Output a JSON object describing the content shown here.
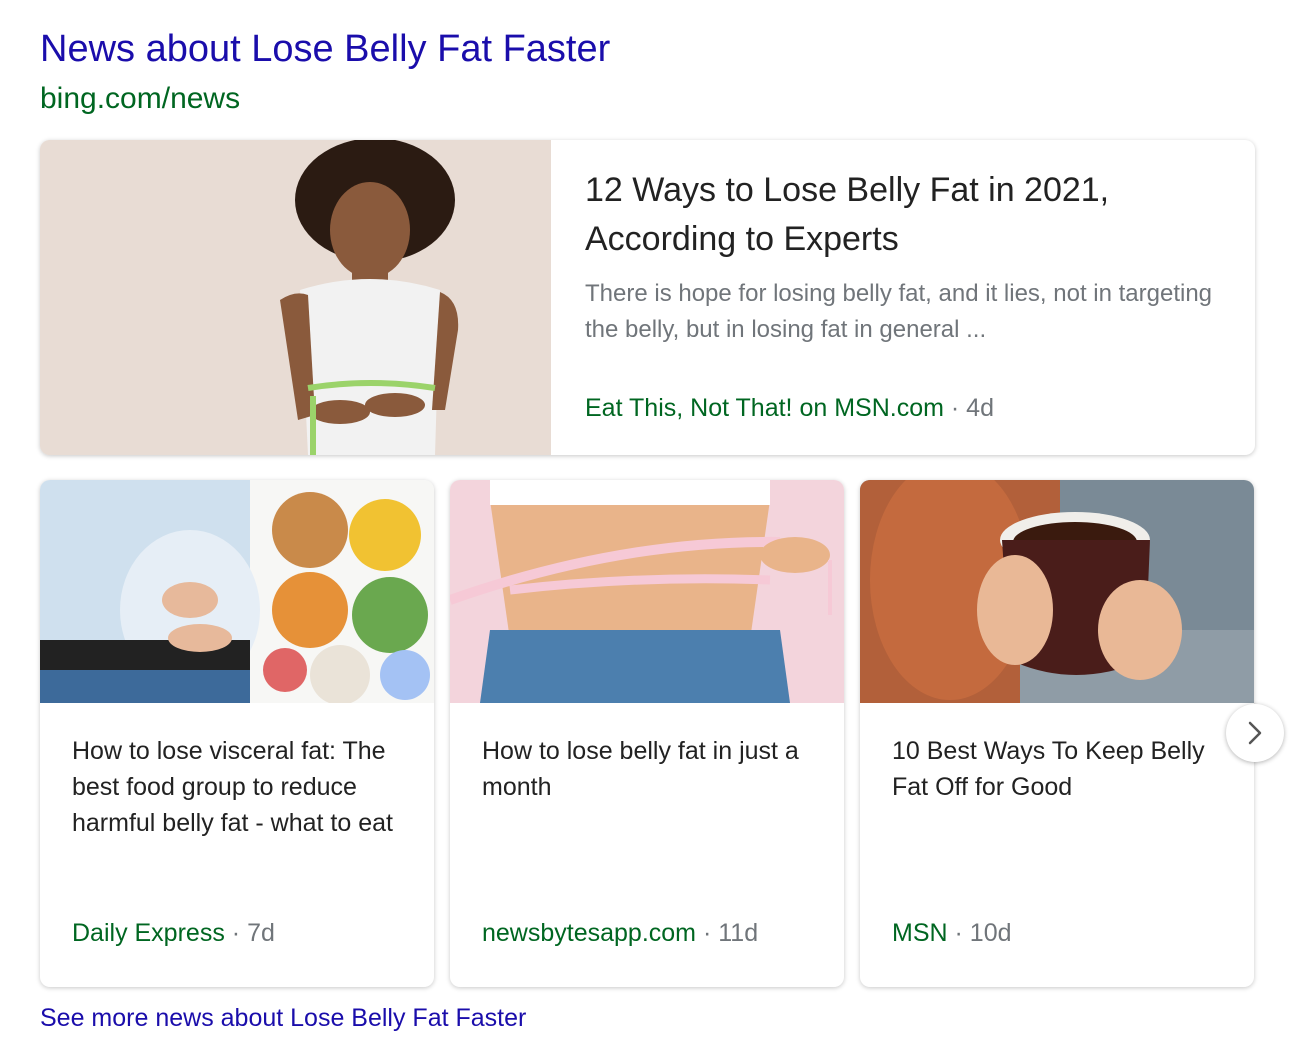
{
  "header": {
    "title": "News about Lose Belly Fat Faster",
    "url": "bing.com/news"
  },
  "hero": {
    "title": "12 Ways to Lose Belly Fat in 2021, According to Experts",
    "snippet": "There is hope for losing belly fat, and it lies, not in targeting the belly, but in losing fat in general ...",
    "source": "Eat This, Not That! on MSN.com",
    "separator": "·",
    "age": "4d"
  },
  "cards": [
    {
      "title": "How to lose visceral fat: The best food group to reduce harmful belly fat - what to eat",
      "source": "Daily Express",
      "separator": "·",
      "age": "7d"
    },
    {
      "title": "How to lose belly fat in just a month",
      "source": "newsbytesapp.com",
      "separator": "·",
      "age": "11d"
    },
    {
      "title": "10 Best Ways To Keep Belly Fat Off for Good",
      "source": "MSN",
      "separator": "·",
      "age": "10d"
    }
  ],
  "footer": {
    "see_more": "See more news about Lose Belly Fat Faster"
  },
  "icons": {
    "next": "chevron-right-icon"
  },
  "colors": {
    "title_link": "#1a0dab",
    "url_green": "#006621",
    "meta_gray": "#70757a",
    "text": "#222222"
  }
}
